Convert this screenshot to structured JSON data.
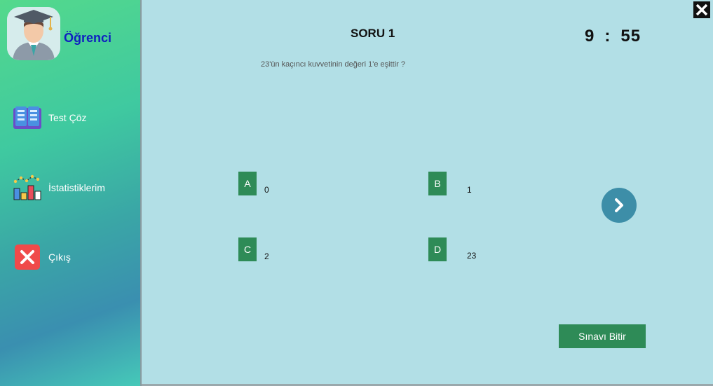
{
  "sidebar": {
    "user_name": "Öğrenci",
    "items": [
      {
        "label": "Test Çöz",
        "icon": "book-icon"
      },
      {
        "label": "İstatistiklerim",
        "icon": "chart-icon"
      },
      {
        "label": "Çıkış",
        "icon": "close-icon"
      }
    ]
  },
  "main": {
    "question_title": "SORU 1",
    "timer": {
      "minutes": "9",
      "separator": ":",
      "seconds": "55"
    },
    "question_text": "23'ün kaçıncı kuvvetinin değeri 1'e eşittir ?",
    "options": [
      {
        "letter": "A",
        "value": "0"
      },
      {
        "letter": "B",
        "value": "1"
      },
      {
        "letter": "C",
        "value": "2"
      },
      {
        "letter": "D",
        "value": "23"
      }
    ],
    "finish_label": "Sınavı Bitir",
    "close_icon": "close-icon",
    "next_icon": "chevron-right-icon"
  },
  "colors": {
    "accent_green": "#2e8b57",
    "panel_bg": "#b2dfe6",
    "next_button": "#3d8ea8",
    "user_name": "#1020c0"
  }
}
